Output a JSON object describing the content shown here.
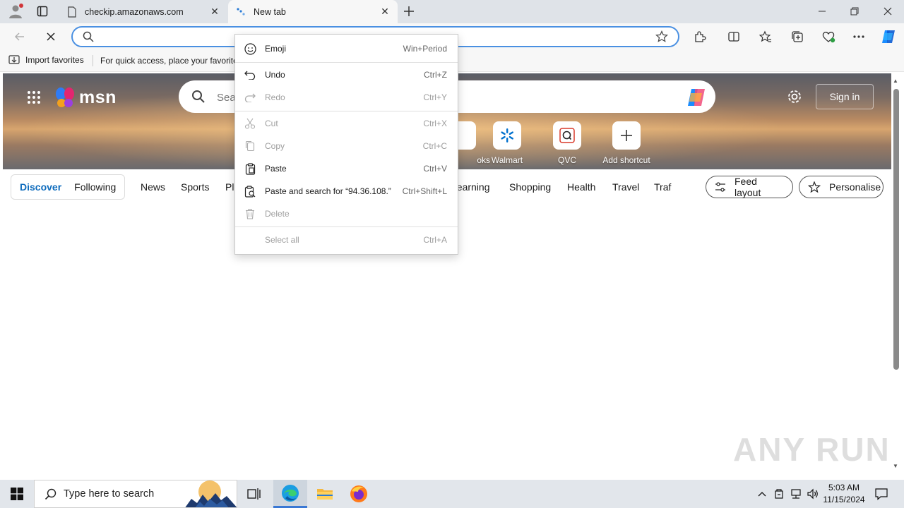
{
  "browser": {
    "tabs": [
      {
        "title": "checkip.amazonaws.com",
        "active": false
      },
      {
        "title": "New tab",
        "active": true
      }
    ],
    "address_bar": {
      "value": "",
      "placeholder": ""
    },
    "favorites_bar": {
      "import_label": "Import favorites",
      "hint": "For quick access, place your favorites here on the favorites bar."
    }
  },
  "msn": {
    "logo_text": "msn",
    "search_placeholder": "Search the web",
    "sign_in_label": "Sign in",
    "shortcuts": [
      {
        "label": "Booking.com",
        "visible_label": "oks"
      },
      {
        "label": "Walmart",
        "icon": "walmart-icon"
      },
      {
        "label": "QVC",
        "icon": "qvc-icon"
      },
      {
        "label": "Add shortcut",
        "icon": "plus-icon"
      }
    ],
    "nav": {
      "discover": "Discover",
      "following": "Following",
      "categories": [
        "News",
        "Sports",
        "Play",
        "Learning",
        "Shopping",
        "Health",
        "Travel",
        "Traf"
      ],
      "feed_layout": "Feed layout",
      "personalise": "Personalise"
    }
  },
  "context_menu": {
    "items": [
      {
        "label": "Emoji",
        "shortcut": "Win+Period",
        "icon": "emoji-icon",
        "enabled": true
      },
      {
        "label": "Undo",
        "shortcut": "Ctrl+Z",
        "icon": "undo-icon",
        "enabled": true
      },
      {
        "label": "Redo",
        "shortcut": "Ctrl+Y",
        "icon": "redo-icon",
        "enabled": false
      },
      {
        "label": "Cut",
        "shortcut": "Ctrl+X",
        "icon": "cut-icon",
        "enabled": false
      },
      {
        "label": "Copy",
        "shortcut": "Ctrl+C",
        "icon": "copy-icon",
        "enabled": false
      },
      {
        "label": "Paste",
        "shortcut": "Ctrl+V",
        "icon": "paste-icon",
        "enabled": true
      },
      {
        "label": "Paste and search for “94.36.108.”",
        "shortcut": "Ctrl+Shift+L",
        "icon": "paste-search-icon",
        "enabled": true
      },
      {
        "label": "Delete",
        "shortcut": "",
        "icon": "delete-icon",
        "enabled": false
      },
      {
        "label": "Select all",
        "shortcut": "Ctrl+A",
        "icon": "",
        "enabled": false
      }
    ]
  },
  "taskbar": {
    "search_placeholder": "Type here to search",
    "time": "5:03 AM",
    "date": "11/15/2024"
  },
  "watermark": "ANY RUN",
  "colors": {
    "accent": "#0f6cbd",
    "address_border": "#4a90e2",
    "taskbar": "#e2e6eb"
  }
}
